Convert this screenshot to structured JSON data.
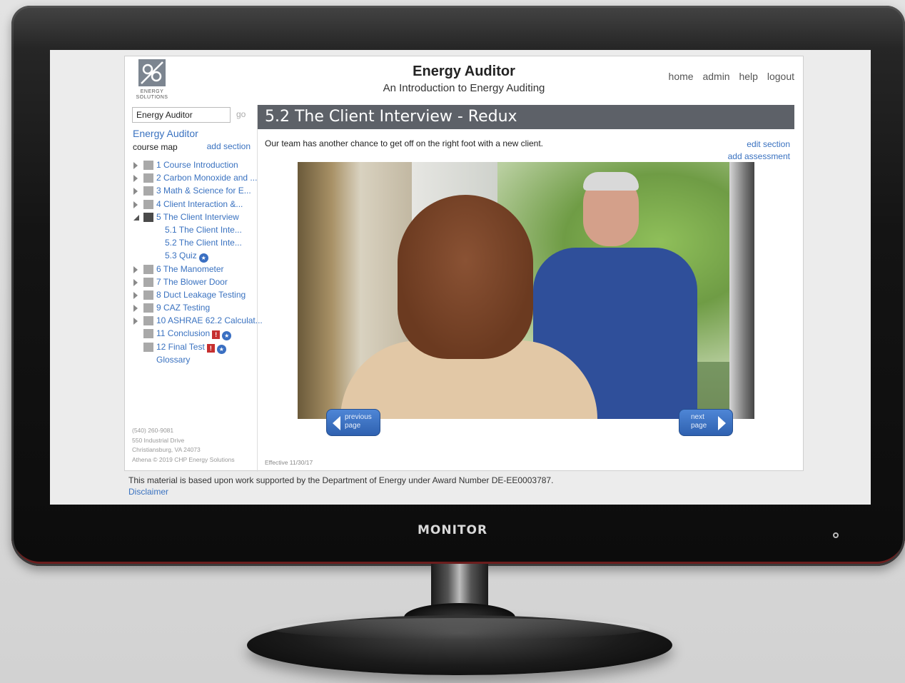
{
  "monitor": {
    "brand": "MONITOR"
  },
  "header": {
    "logo_text_line1": "ENERGY",
    "logo_text_line2": "SOLUTIONS",
    "title": "Energy Auditor",
    "subtitle": "An Introduction to Energy Auditing",
    "nav": [
      "home",
      "admin",
      "help",
      "logout"
    ]
  },
  "sidebar": {
    "search": {
      "value": "Energy Auditor",
      "go_label": "go"
    },
    "course_link": "Energy Auditor",
    "course_map_label": "course map",
    "add_section_label": "add section",
    "tree": [
      {
        "label": "1 Course Introduction",
        "expandable": true
      },
      {
        "label": "2 Carbon Monoxide and ...",
        "expandable": true
      },
      {
        "label": "3 Math & Science for E...",
        "expandable": true
      },
      {
        "label": "4 Client Interaction &...",
        "expandable": true
      },
      {
        "label": "5 The Client Interview",
        "expandable": true,
        "open": true
      },
      {
        "label": "5.1 The Client Inte...",
        "sub": true
      },
      {
        "label": "5.2 The Client Inte...",
        "sub": true
      },
      {
        "label": "5.3 Quiz",
        "sub": true,
        "badges": [
          "blue-star"
        ]
      },
      {
        "label": "6 The Manometer",
        "expandable": true
      },
      {
        "label": "7 The Blower Door",
        "expandable": true
      },
      {
        "label": "8 Duct Leakage Testing",
        "expandable": true
      },
      {
        "label": "9 CAZ Testing",
        "expandable": true
      },
      {
        "label": "10 ASHRAE 62.2 Calculat...",
        "expandable": true
      },
      {
        "label": "11 Conclusion",
        "badges": [
          "red-alert",
          "blue-star"
        ]
      },
      {
        "label": "12 Final Test",
        "badges": [
          "red-alert",
          "blue-star"
        ]
      },
      {
        "label": "Glossary",
        "glossary": true
      }
    ],
    "address": [
      "(540) 260-9081",
      "550 Industrial Drive",
      "Christiansburg, VA 24073",
      "Athena © 2019 CHP Energy Solutions"
    ]
  },
  "main": {
    "heading": "5.2 The Client Interview - Redux",
    "intro": "Our team has another chance to get off on the right foot with a new client.",
    "edit_section_label": "edit section",
    "add_assessment_label": "add assessment",
    "prev_button": {
      "line1": "previous",
      "line2": "page"
    },
    "next_button": {
      "line1": "next",
      "line2": "page"
    },
    "effective": "Effective 11/30/17"
  },
  "footer": {
    "note": "This material is based upon work supported by the Department of Energy under Award Number DE-EE0003787.",
    "disclaimer": "Disclaimer"
  },
  "colors": {
    "link": "#3a72c0",
    "heading_bar": "#5d6168",
    "button": "#3a6fc2",
    "alert_badge": "#c62f2f"
  },
  "icons": {
    "expand": "triangle-right-icon",
    "collapse": "triangle-down-icon",
    "section": "book-icon",
    "alert": "alert-badge-icon",
    "star": "star-badge-icon"
  }
}
